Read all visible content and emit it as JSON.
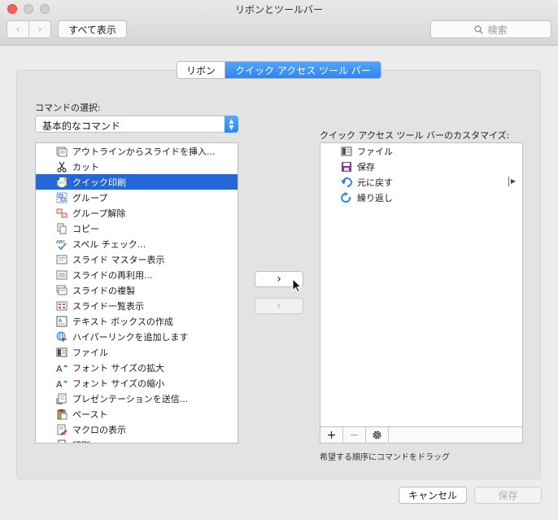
{
  "window": {
    "title": "リボンとツールバー"
  },
  "toolbar": {
    "back_glyph": "‹",
    "forward_glyph": "›",
    "show_all_label": "すべて表示",
    "search_placeholder": "検索"
  },
  "tabs": [
    {
      "label": "リボン",
      "selected": false
    },
    {
      "label": "クイック アクセス ツール バー",
      "selected": true
    }
  ],
  "commands": {
    "label": "コマンドの選択:",
    "selected_category": "基本的なコマンド",
    "items": [
      {
        "label": "アウトラインからスライドを挿入...",
        "icon": "outline-insert-icon"
      },
      {
        "label": "カット",
        "icon": "scissors-icon"
      },
      {
        "label": "クイック印刷",
        "icon": "quick-print-icon",
        "selected": true
      },
      {
        "label": "グループ",
        "icon": "group-icon"
      },
      {
        "label": "グループ解除",
        "icon": "ungroup-icon"
      },
      {
        "label": "コピー",
        "icon": "copy-icon"
      },
      {
        "label": "スペル チェック...",
        "icon": "spellcheck-icon"
      },
      {
        "label": "スライド マスター表示",
        "icon": "slide-master-icon"
      },
      {
        "label": "スライドの再利用...",
        "icon": "slide-reuse-icon"
      },
      {
        "label": "スライドの複製",
        "icon": "slide-duplicate-icon"
      },
      {
        "label": "スライド一覧表示",
        "icon": "slide-sorter-icon"
      },
      {
        "label": "テキスト ボックスの作成",
        "icon": "textbox-icon"
      },
      {
        "label": "ハイパーリンクを追加します",
        "icon": "hyperlink-icon"
      },
      {
        "label": "ファイル",
        "icon": "file-icon"
      },
      {
        "label": "フォント サイズの拡大",
        "icon": "font-grow-icon"
      },
      {
        "label": "フォント サイズの縮小",
        "icon": "font-shrink-icon"
      },
      {
        "label": "プレゼンテーションを送信...",
        "icon": "send-icon"
      },
      {
        "label": "ペースト",
        "icon": "paste-icon"
      },
      {
        "label": "マクロの表示",
        "icon": "macro-icon"
      },
      {
        "label": "印刷",
        "icon": "print-icon"
      }
    ]
  },
  "transfer": {
    "add_glyph": "›",
    "remove_glyph": "‹"
  },
  "quick_access": {
    "label": "クイック アクセス ツール バーのカスタマイズ:",
    "items": [
      {
        "label": "ファイル",
        "icon": "file-icon"
      },
      {
        "label": "保存",
        "icon": "save-icon"
      },
      {
        "label": "元に戻す",
        "icon": "undo-icon",
        "has_submenu": true
      },
      {
        "label": "繰り返し",
        "icon": "redo-icon"
      }
    ],
    "footer": {
      "add_glyph": "+",
      "remove_glyph": "−",
      "settings_icon": "gear-icon"
    },
    "hint": "希望する順序にコマンドをドラッグ"
  },
  "buttons": {
    "cancel_label": "キャンセル",
    "save_label": "保存"
  },
  "colors": {
    "accent": "#2b86f5",
    "selection": "#2567d6",
    "close": "#fc5f57"
  }
}
